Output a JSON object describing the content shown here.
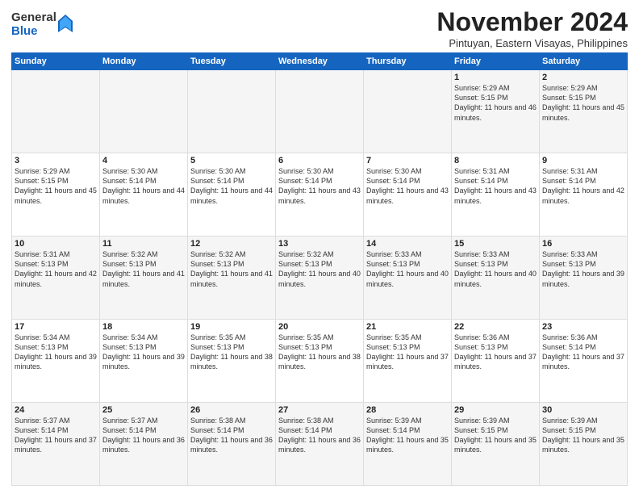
{
  "logo": {
    "general": "General",
    "blue": "Blue"
  },
  "header": {
    "month": "November 2024",
    "location": "Pintuyan, Eastern Visayas, Philippines"
  },
  "weekdays": [
    "Sunday",
    "Monday",
    "Tuesday",
    "Wednesday",
    "Thursday",
    "Friday",
    "Saturday"
  ],
  "weeks": [
    [
      {
        "day": "",
        "info": ""
      },
      {
        "day": "",
        "info": ""
      },
      {
        "day": "",
        "info": ""
      },
      {
        "day": "",
        "info": ""
      },
      {
        "day": "",
        "info": ""
      },
      {
        "day": "1",
        "info": "Sunrise: 5:29 AM\nSunset: 5:15 PM\nDaylight: 11 hours and 46 minutes."
      },
      {
        "day": "2",
        "info": "Sunrise: 5:29 AM\nSunset: 5:15 PM\nDaylight: 11 hours and 45 minutes."
      }
    ],
    [
      {
        "day": "3",
        "info": "Sunrise: 5:29 AM\nSunset: 5:15 PM\nDaylight: 11 hours and 45 minutes."
      },
      {
        "day": "4",
        "info": "Sunrise: 5:30 AM\nSunset: 5:14 PM\nDaylight: 11 hours and 44 minutes."
      },
      {
        "day": "5",
        "info": "Sunrise: 5:30 AM\nSunset: 5:14 PM\nDaylight: 11 hours and 44 minutes."
      },
      {
        "day": "6",
        "info": "Sunrise: 5:30 AM\nSunset: 5:14 PM\nDaylight: 11 hours and 43 minutes."
      },
      {
        "day": "7",
        "info": "Sunrise: 5:30 AM\nSunset: 5:14 PM\nDaylight: 11 hours and 43 minutes."
      },
      {
        "day": "8",
        "info": "Sunrise: 5:31 AM\nSunset: 5:14 PM\nDaylight: 11 hours and 43 minutes."
      },
      {
        "day": "9",
        "info": "Sunrise: 5:31 AM\nSunset: 5:14 PM\nDaylight: 11 hours and 42 minutes."
      }
    ],
    [
      {
        "day": "10",
        "info": "Sunrise: 5:31 AM\nSunset: 5:13 PM\nDaylight: 11 hours and 42 minutes."
      },
      {
        "day": "11",
        "info": "Sunrise: 5:32 AM\nSunset: 5:13 PM\nDaylight: 11 hours and 41 minutes."
      },
      {
        "day": "12",
        "info": "Sunrise: 5:32 AM\nSunset: 5:13 PM\nDaylight: 11 hours and 41 minutes."
      },
      {
        "day": "13",
        "info": "Sunrise: 5:32 AM\nSunset: 5:13 PM\nDaylight: 11 hours and 40 minutes."
      },
      {
        "day": "14",
        "info": "Sunrise: 5:33 AM\nSunset: 5:13 PM\nDaylight: 11 hours and 40 minutes."
      },
      {
        "day": "15",
        "info": "Sunrise: 5:33 AM\nSunset: 5:13 PM\nDaylight: 11 hours and 40 minutes."
      },
      {
        "day": "16",
        "info": "Sunrise: 5:33 AM\nSunset: 5:13 PM\nDaylight: 11 hours and 39 minutes."
      }
    ],
    [
      {
        "day": "17",
        "info": "Sunrise: 5:34 AM\nSunset: 5:13 PM\nDaylight: 11 hours and 39 minutes."
      },
      {
        "day": "18",
        "info": "Sunrise: 5:34 AM\nSunset: 5:13 PM\nDaylight: 11 hours and 39 minutes."
      },
      {
        "day": "19",
        "info": "Sunrise: 5:35 AM\nSunset: 5:13 PM\nDaylight: 11 hours and 38 minutes."
      },
      {
        "day": "20",
        "info": "Sunrise: 5:35 AM\nSunset: 5:13 PM\nDaylight: 11 hours and 38 minutes."
      },
      {
        "day": "21",
        "info": "Sunrise: 5:35 AM\nSunset: 5:13 PM\nDaylight: 11 hours and 37 minutes."
      },
      {
        "day": "22",
        "info": "Sunrise: 5:36 AM\nSunset: 5:13 PM\nDaylight: 11 hours and 37 minutes."
      },
      {
        "day": "23",
        "info": "Sunrise: 5:36 AM\nSunset: 5:14 PM\nDaylight: 11 hours and 37 minutes."
      }
    ],
    [
      {
        "day": "24",
        "info": "Sunrise: 5:37 AM\nSunset: 5:14 PM\nDaylight: 11 hours and 37 minutes."
      },
      {
        "day": "25",
        "info": "Sunrise: 5:37 AM\nSunset: 5:14 PM\nDaylight: 11 hours and 36 minutes."
      },
      {
        "day": "26",
        "info": "Sunrise: 5:38 AM\nSunset: 5:14 PM\nDaylight: 11 hours and 36 minutes."
      },
      {
        "day": "27",
        "info": "Sunrise: 5:38 AM\nSunset: 5:14 PM\nDaylight: 11 hours and 36 minutes."
      },
      {
        "day": "28",
        "info": "Sunrise: 5:39 AM\nSunset: 5:14 PM\nDaylight: 11 hours and 35 minutes."
      },
      {
        "day": "29",
        "info": "Sunrise: 5:39 AM\nSunset: 5:15 PM\nDaylight: 11 hours and 35 minutes."
      },
      {
        "day": "30",
        "info": "Sunrise: 5:39 AM\nSunset: 5:15 PM\nDaylight: 11 hours and 35 minutes."
      }
    ]
  ]
}
